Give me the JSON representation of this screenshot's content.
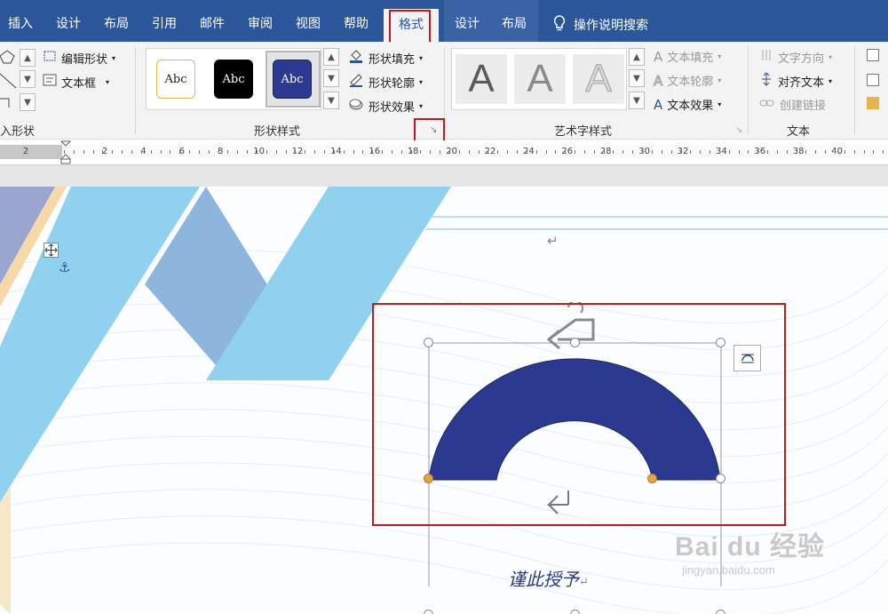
{
  "tabs": {
    "insert": "插入",
    "design": "设计",
    "layout": "布局",
    "references": "引用",
    "mailings": "邮件",
    "review": "审阅",
    "view": "视图",
    "help": "帮助",
    "format": "格式",
    "ctx_design": "设计",
    "ctx_layout": "布局"
  },
  "search": {
    "label": "操作说明搜索"
  },
  "ribbon": {
    "insert_shapes": {
      "edit_shape": "编辑形状",
      "text_box": "文本框",
      "label": "入形状"
    },
    "shape_styles": {
      "sample_text": "Abc",
      "fill": "形状填充",
      "outline": "形状轮廓",
      "effects": "形状效果",
      "label": "形状样式"
    },
    "wordart": {
      "letter": "A",
      "text_fill": "文本填充",
      "text_outline": "文本轮廓",
      "text_effects": "文本效果",
      "label": "艺术字样式"
    },
    "text_group": {
      "direction": "文字方向",
      "align": "对齐文本",
      "link": "创建链接",
      "label": "文本"
    }
  },
  "ruler": {
    "labels": [
      "2",
      "2",
      "4",
      "6",
      "8",
      "10",
      "12",
      "14",
      "16",
      "18",
      "20",
      "22",
      "24",
      "26",
      "28",
      "30",
      "32",
      "34",
      "36",
      "38",
      "40"
    ]
  },
  "document": {
    "caption": "谨此授予",
    "shape_color": "#2b3990",
    "watermark_logo": "Bai du 经验",
    "watermark_url": "jingyan.baidu.com"
  },
  "colors": {
    "title_bar": "#2b579a",
    "highlight": "#c8181e",
    "decor_light_blue": "#8fd1ef",
    "decor_purple": "#8fa0c8"
  }
}
